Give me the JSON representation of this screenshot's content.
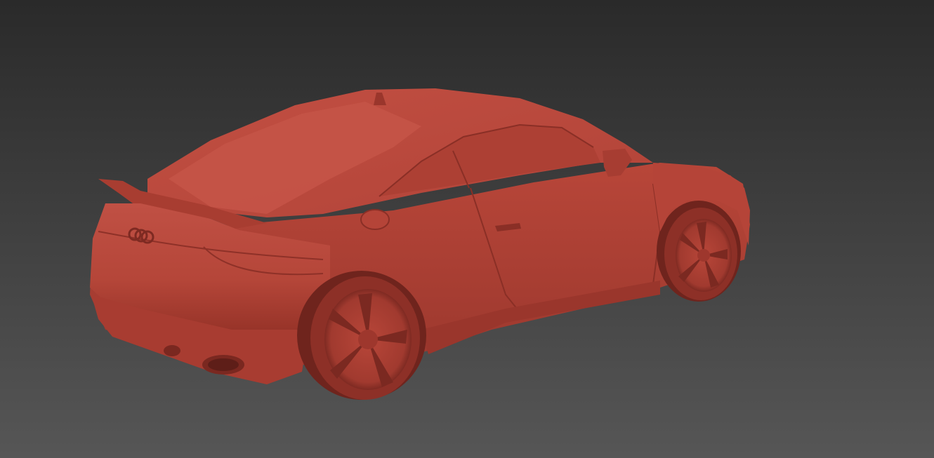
{
  "viewport": {
    "background_top": "#2a2a2a",
    "background_bottom": "#555555"
  },
  "model": {
    "subject": "red-coupe-3d-model",
    "body_color": "#b8463a",
    "body_light": "#cc5a4c",
    "body_dark": "#8e3128",
    "shadow_color": "#6f241d"
  }
}
